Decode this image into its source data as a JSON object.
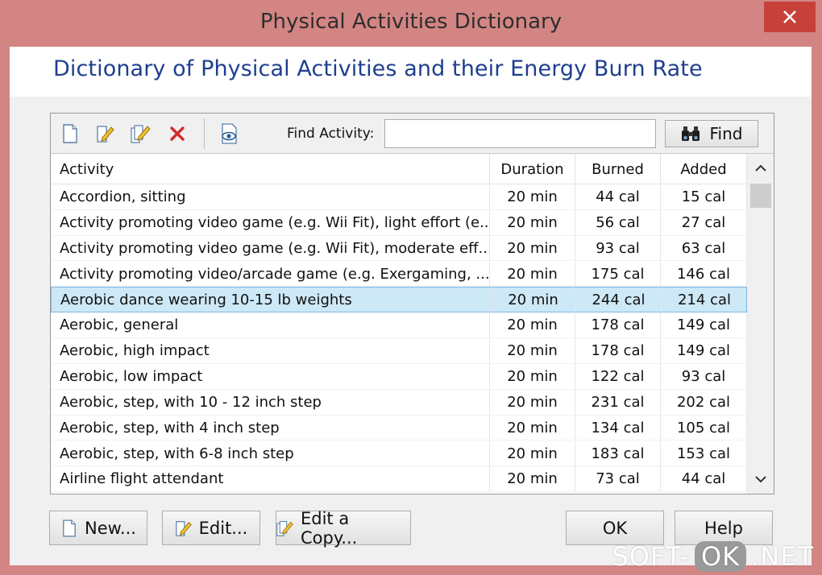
{
  "window": {
    "title": "Physical Activities Dictionary"
  },
  "header": {
    "title": "Dictionary of Physical Activities and their Energy Burn Rate"
  },
  "toolbar": {
    "icons": [
      "new-document-icon",
      "edit-icon",
      "edit-copy-icon",
      "delete-icon",
      "view-icon"
    ],
    "find_label": "Find Activity:",
    "find_value": "",
    "find_button": "Find"
  },
  "table": {
    "columns": [
      "Activity",
      "Duration",
      "Burned",
      "Added"
    ],
    "rows": [
      {
        "activity": "Accordion, sitting",
        "duration": "20 min",
        "burned": "44 cal",
        "added": "15 cal"
      },
      {
        "activity": "Activity promoting video game (e.g. Wii Fit), light effort (e....",
        "duration": "20 min",
        "burned": "56 cal",
        "added": "27 cal"
      },
      {
        "activity": "Activity promoting video game (e.g. Wii Fit), moderate eff...",
        "duration": "20 min",
        "burned": "93 cal",
        "added": "63 cal"
      },
      {
        "activity": "Activity promoting video/arcade game (e.g. Exergaming, ...",
        "duration": "20 min",
        "burned": "175 cal",
        "added": "146 cal"
      },
      {
        "activity": "Aerobic dance wearing 10-15 lb weights",
        "duration": "20 min",
        "burned": "244 cal",
        "added": "214 cal"
      },
      {
        "activity": "Aerobic, general",
        "duration": "20 min",
        "burned": "178 cal",
        "added": "149 cal"
      },
      {
        "activity": "Aerobic, high impact",
        "duration": "20 min",
        "burned": "178 cal",
        "added": "149 cal"
      },
      {
        "activity": "Aerobic, low impact",
        "duration": "20 min",
        "burned": "122 cal",
        "added": "93 cal"
      },
      {
        "activity": "Aerobic, step, with 10 - 12 inch step",
        "duration": "20 min",
        "burned": "231 cal",
        "added": "202 cal"
      },
      {
        "activity": "Aerobic, step, with 4 inch step",
        "duration": "20 min",
        "burned": "134 cal",
        "added": "105 cal"
      },
      {
        "activity": "Aerobic, step, with 6-8 inch step",
        "duration": "20 min",
        "burned": "183 cal",
        "added": "153 cal"
      },
      {
        "activity": "Airline flight attendant",
        "duration": "20 min",
        "burned": "73 cal",
        "added": "44 cal"
      }
    ],
    "selected_index": 4
  },
  "buttons": {
    "new": "New...",
    "edit": "Edit...",
    "edit_copy": "Edit a Copy...",
    "ok": "OK",
    "help": "Help"
  },
  "watermark": {
    "left": "SOFT-",
    "pill": "OK",
    "right": ".NET"
  },
  "colors": {
    "frame": "#d38583",
    "header_title": "#1e3f8f",
    "selection": "#cde8f7",
    "close": "#c7413b"
  }
}
